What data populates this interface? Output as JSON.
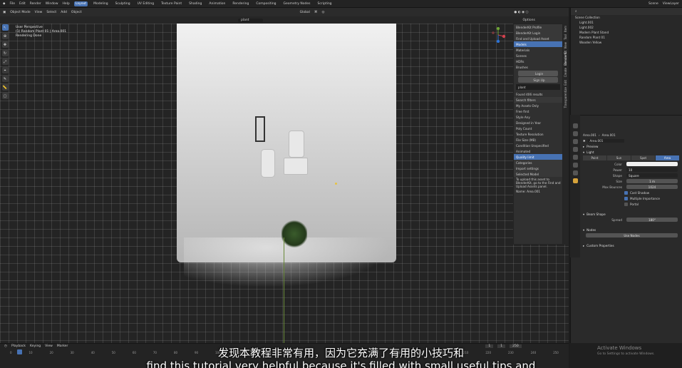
{
  "menu": {
    "items": [
      "File",
      "Edit",
      "Render",
      "Window",
      "Help"
    ],
    "workspaces": [
      "Layout",
      "Modeling",
      "Sculpting",
      "UV Editing",
      "Texture Paint",
      "Shading",
      "Animation",
      "Rendering",
      "Compositing",
      "Geometry Nodes",
      "Scripting"
    ],
    "active_workspace": "Layout",
    "scene": "Scene",
    "view_layer": "ViewLayer"
  },
  "viewport_header": {
    "mode": "Object Mode",
    "menus": [
      "View",
      "Select",
      "Add",
      "Object"
    ],
    "transform": "Global",
    "search": "plant",
    "options": "Options"
  },
  "viewport_info": {
    "line1": "User Perspective",
    "line2": "(1) Random Plant 01 | Area.001",
    "line3": "Rendering Done"
  },
  "npanel": {
    "tabs": [
      "Item",
      "Tool",
      "View",
      "BlenderKit",
      "Create",
      "Edit",
      "Transparentize"
    ],
    "rows": [
      "BlenderKit Profile",
      "BlenderKit Login",
      "Find and Upload Asset",
      "Models",
      "Materials",
      "Scenes",
      "HDRs",
      "Brushes",
      "Login",
      "Sign Up",
      "plant",
      "Found 406 results",
      "Search filters",
      "My Assets Only",
      "Free first",
      "Style   Any",
      "Designed in Year",
      "Poly Count",
      "Texture Resolution",
      "File Size (MB)",
      "Condition   Unspecified",
      "Animated",
      "Quality limit",
      "Categories",
      "Import settings",
      "Selected Model",
      "To upload this asset to BlenderKit, go to the Find and Upload Assets panel.",
      "Name: Area.001"
    ]
  },
  "outliner": {
    "title": "Scene Collection",
    "items": [
      "Light.001",
      "Light.002",
      "Modern Plant Stand",
      "Random Plant 01",
      "Wooden Yellow"
    ]
  },
  "properties": {
    "breadcrumb": [
      "Area.001",
      "Area.001"
    ],
    "datablock": "Area.001",
    "sections": [
      "Preview",
      "Light"
    ],
    "light_types": [
      "Point",
      "Sun",
      "Spot",
      "Area"
    ],
    "active_light_type": "Area",
    "fields": [
      {
        "label": "Color",
        "value": ""
      },
      {
        "label": "Power",
        "value": "10"
      },
      {
        "label": "Shape",
        "value": "Square"
      },
      {
        "label": "Size",
        "value": "1 m"
      },
      {
        "label": "Max Bounces",
        "value": "1024"
      }
    ],
    "checks": [
      "Cast Shadow",
      "Multiple Importance",
      "Portal"
    ],
    "beam_shape": "Beam Shape",
    "spread_label": "Spread",
    "spread": "180°",
    "nodes": "Nodes",
    "use_nodes": "Use Nodes",
    "custom": "Custom Properties"
  },
  "timeline": {
    "menus": [
      "Playback",
      "Keying",
      "View",
      "Marker"
    ],
    "frames": [
      "0",
      "10",
      "20",
      "30",
      "40",
      "50",
      "60",
      "70",
      "80",
      "90",
      "100",
      "110",
      "120",
      "130",
      "140",
      "150",
      "160",
      "170",
      "180",
      "190",
      "200",
      "210",
      "220",
      "230",
      "240",
      "250"
    ],
    "current": "1",
    "start": "1",
    "end": "250"
  },
  "watermark": {
    "line1": "Activate Windows",
    "line2": "Go to Settings to activate Windows."
  },
  "subtitles": {
    "cn": "发现本教程非常有用，因为它充满了有用的小技巧和",
    "en": "find this tutorial very helpful because it's filled with small useful tips and"
  }
}
